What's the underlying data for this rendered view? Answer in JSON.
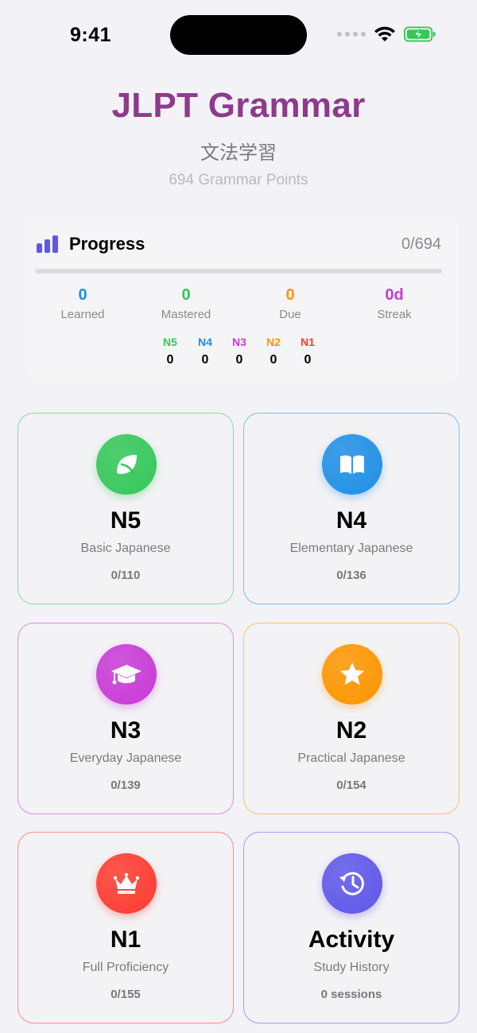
{
  "status_bar": {
    "time": "9:41"
  },
  "header": {
    "title": "JLPT Grammar",
    "subtitle": "文法学習",
    "count": "694 Grammar Points"
  },
  "progress": {
    "title": "Progress",
    "ratio": "0/694",
    "fraction": 0,
    "stats": [
      {
        "value": "0",
        "label": "Learned",
        "color": "#1f8fe6"
      },
      {
        "value": "0",
        "label": "Mastered",
        "color": "#34c759"
      },
      {
        "value": "0",
        "label": "Due",
        "color": "#ff9500"
      },
      {
        "value": "0d",
        "label": "Streak",
        "color": "#c83ad6"
      }
    ],
    "levels": [
      {
        "name": "N5",
        "value": "0",
        "color": "#34c759"
      },
      {
        "name": "N4",
        "value": "0",
        "color": "#1f8fe6"
      },
      {
        "name": "N3",
        "value": "0",
        "color": "#c83ad6"
      },
      {
        "name": "N2",
        "value": "0",
        "color": "#ff9500"
      },
      {
        "name": "N1",
        "value": "0",
        "color": "#ff3b30"
      }
    ]
  },
  "cards": [
    {
      "title": "N5",
      "subtitle": "Basic Japanese",
      "progress": "0/110",
      "icon": "leaf-icon",
      "color": "#34c759"
    },
    {
      "title": "N4",
      "subtitle": "Elementary Japanese",
      "progress": "0/136",
      "icon": "book-icon",
      "color": "#1f8fe6"
    },
    {
      "title": "N3",
      "subtitle": "Everyday Japanese",
      "progress": "0/139",
      "icon": "graduation-cap-icon",
      "color": "#c83ad6"
    },
    {
      "title": "N2",
      "subtitle": "Practical Japanese",
      "progress": "0/154",
      "icon": "star-icon",
      "color": "#ff9500"
    },
    {
      "title": "N1",
      "subtitle": "Full Proficiency",
      "progress": "0/155",
      "icon": "crown-icon",
      "color": "#ff3b30"
    },
    {
      "title": "Activity",
      "subtitle": "Study History",
      "progress": "0 sessions",
      "icon": "history-clock-icon",
      "color": "#5e57e8"
    }
  ]
}
